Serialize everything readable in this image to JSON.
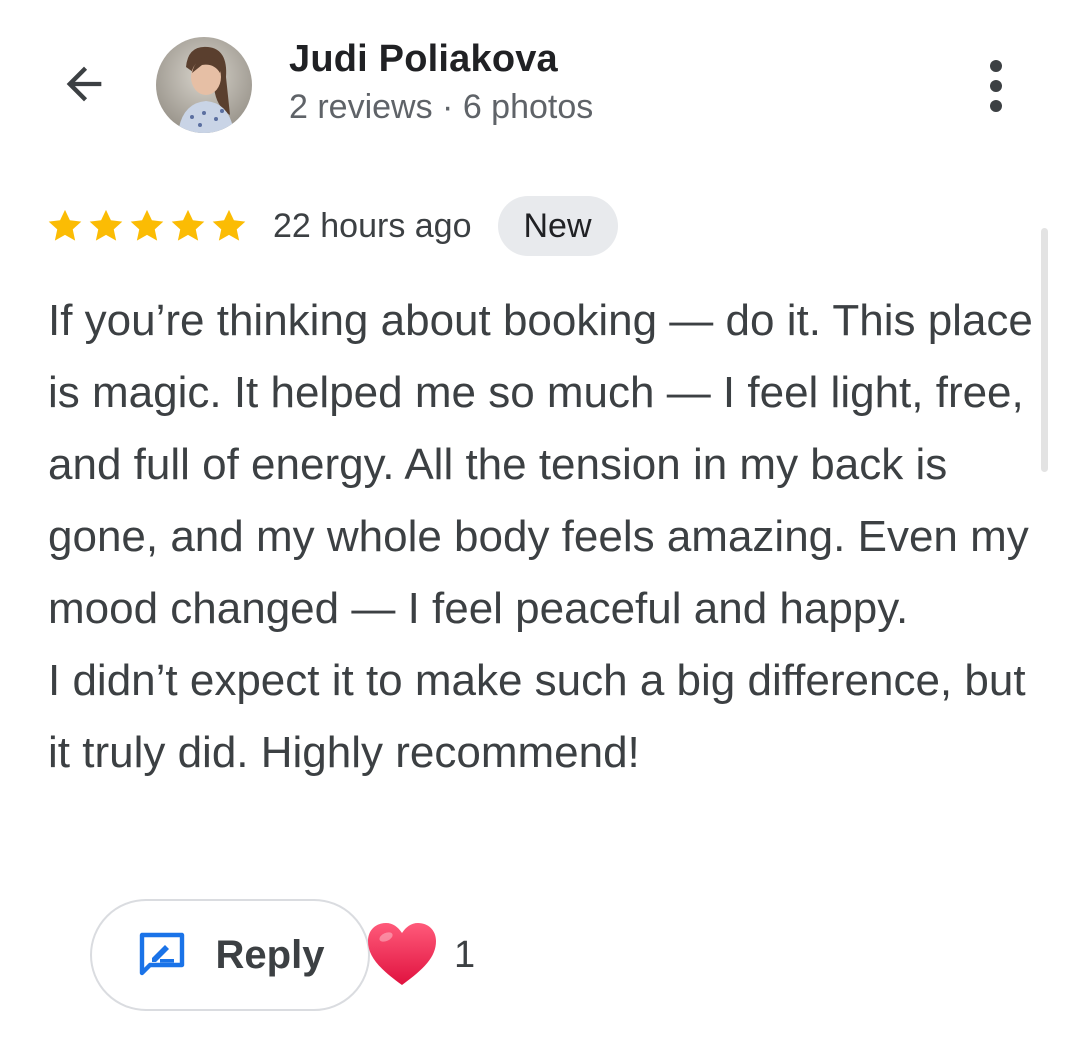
{
  "header": {
    "back_icon": "arrow-back-icon",
    "user_name": "Judi Poliakova",
    "user_stats": "2 reviews · 6 photos",
    "menu_icon": "more-vert-icon"
  },
  "review": {
    "rating": 5,
    "rating_max": 5,
    "star_color": "#fbbc04",
    "time_ago": "22 hours ago",
    "badge": "New",
    "paragraphs": [
      "If you’re thinking about booking — do it. This place is magic. It helped me so much — I feel light, free, and full of energy. All the tension in my back is gone, and my whole body feels amazing. Even my mood changed — I feel peaceful and happy.",
      "I didn’t expect it to make such a big difference, but it truly did. Highly recommend!"
    ]
  },
  "actions": {
    "reply_label": "Reply",
    "reply_icon": "rate-review-icon",
    "reply_icon_color": "#1a73e8",
    "reaction_icon": "heart-icon",
    "reaction_color": "#f0264f",
    "reaction_count": "1"
  }
}
